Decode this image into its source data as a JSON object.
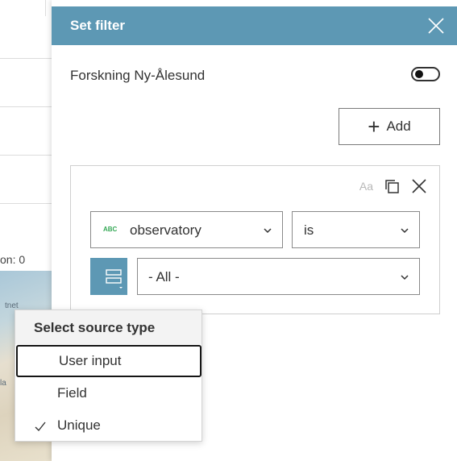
{
  "background": {
    "partial_label": "on: 0",
    "map_text_top": "tnet",
    "map_text_bottom": "la"
  },
  "panel": {
    "title": "Set filter",
    "layer_name": "Forskning Ny-Ålesund",
    "layer_toggle_on": false,
    "add_label": "Add",
    "accent_color": "#5d98b4"
  },
  "filter": {
    "case_label": "Aa",
    "field_type_badge": "ABC",
    "field_value": "observatory",
    "operator_value": "is",
    "value_value": "- All -"
  },
  "source_menu": {
    "title": "Select source type",
    "items": [
      {
        "label": "User input",
        "focused": true,
        "checked": false
      },
      {
        "label": "Field",
        "focused": false,
        "checked": false
      },
      {
        "label": "Unique",
        "focused": false,
        "checked": true
      }
    ]
  }
}
